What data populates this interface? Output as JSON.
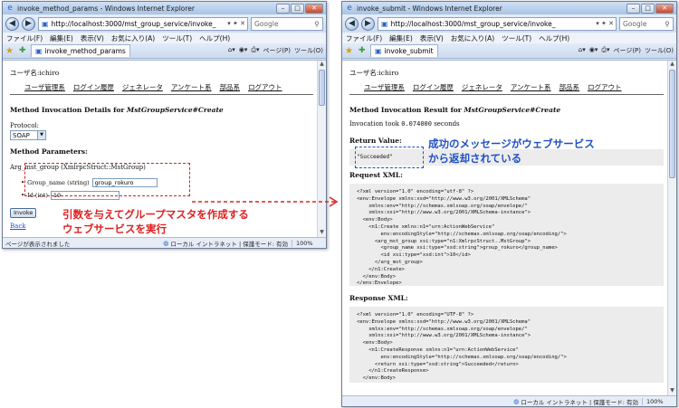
{
  "window1": {
    "title": "invoke_method_params - Windows Internet Explorer",
    "address": "http://localhost:3000/mst_group_service/invoke_",
    "search_placeholder": "Google",
    "menu": [
      "ファイル(F)",
      "編集(E)",
      "表示(V)",
      "お気に入り(A)",
      "ツール(T)",
      "ヘルプ(H)"
    ],
    "tab_label": "invoke_method_params",
    "tab_tools": [
      "ページ(P)",
      "ツール(O)"
    ],
    "user_line": "ユーザ名:ichiro",
    "nav": [
      "ユーザ管理系",
      "ログイン履歴",
      "ジェネレータ",
      "アンケート系",
      "部品系",
      "ログアウト"
    ],
    "heading_prefix": "Method Invocation Details for ",
    "heading_service": "MstGroupService#Create",
    "protocol_label": "Protocol:",
    "protocol_value": "SOAP",
    "params_label": "Method Parameters:",
    "arg_line": "Arg_mst_group (XmlrpcStruct::MstGroup)",
    "params": [
      {
        "label": "Group_name (string)",
        "value": "group_rokuro"
      },
      {
        "label": "Id (int)",
        "value": "10"
      }
    ],
    "invoke_label": "Invoke",
    "back_label": "Back",
    "status_text": "ページが表示されました",
    "zone_text": "ローカル イントラネット | 保護モード: 有効",
    "zoom": "100%"
  },
  "window2": {
    "title": "invoke_submit - Windows Internet Explorer",
    "address": "http://localhost:3000/mst_group_service/invoke_",
    "search_placeholder": "Google",
    "menu": [
      "ファイル(F)",
      "編集(E)",
      "表示(V)",
      "お気に入り(A)",
      "ツール(T)",
      "ヘルプ(H)"
    ],
    "tab_label": "invoke_submit",
    "tab_tools": [
      "ページ(P)",
      "ツール(O)"
    ],
    "user_line": "ユーザ名:ichiro",
    "nav": [
      "ユーザ管理系",
      "ログイン履歴",
      "ジェネレータ",
      "アンケート系",
      "部品系",
      "ログアウト"
    ],
    "heading_prefix": "Method Invocation Result for ",
    "heading_service": "MstGroupService#Create",
    "took_prefix": "Invocation took ",
    "took_value": "0.074000",
    "took_suffix": " seconds",
    "return_label": "Return Value:",
    "return_value": "\"Succeeded\"",
    "request_label": "Request XML:",
    "request_xml": "<?xml version=\"1.0\" encoding=\"utf-8\" ?>\n<env:Envelope xmlns:xsd=\"http://www.w3.org/2001/XMLSchema\"\n    xmlns:env=\"http://schemas.xmlsoap.org/soap/envelope/\"\n    xmlns:xsi=\"http://www.w3.org/2001/XMLSchema-instance\">\n  <env:Body>\n    <n1:Create xmlns:n1=\"urn:ActionWebService\"\n        env:encodingStyle=\"http://schemas.xmlsoap.org/soap/encoding/\">\n      <arg_mst_group xsi:type=\"n1:XmlrpcStruct..MstGroup\">\n        <group_name xsi:type=\"xsd:string\">group_rokuro</group_name>\n        <id xsi:type=\"xsd:int\">10</id>\n      </arg_mst_group>\n    </n1:Create>\n  </env:Body>\n</env:Envelope>",
    "response_label": "Response XML:",
    "response_xml": "<?xml version=\"1.0\" encoding=\"UTF-8\" ?>\n<env:Envelope xmlns:xsd=\"http://www.w3.org/2001/XMLSchema\"\n    xmlns:env=\"http://schemas.xmlsoap.org/soap/envelope/\"\n    xmlns:xsi=\"http://www.w3.org/2001/XMLSchema-instance\">\n  <env:Body>\n    <n1:CreateResponse xmlns:n1=\"urn:ActionWebService\"\n        env:encodingStyle=\"http://schemas.xmlsoap.org/soap/encoding/\">\n      <return xsi:type=\"xsd:string\">Succeeded</return>\n    </n1:CreateResponse>\n  </env:Body>\n</env:Envelope>",
    "zone_text": "ローカル イントラネット | 保護モード: 有効",
    "zoom": "100%"
  },
  "annotations": {
    "red_line1": "引数を与えてグループマスタを作成する",
    "red_line2": "ウェブサービスを実行",
    "blue_line1": "成功のメッセージがウェブサービス",
    "blue_line2": "から返却されている"
  },
  "colors": {
    "annotation_red": "#e02020",
    "annotation_blue": "#1f4fc4",
    "chrome_blue": "#dbe6f4"
  }
}
